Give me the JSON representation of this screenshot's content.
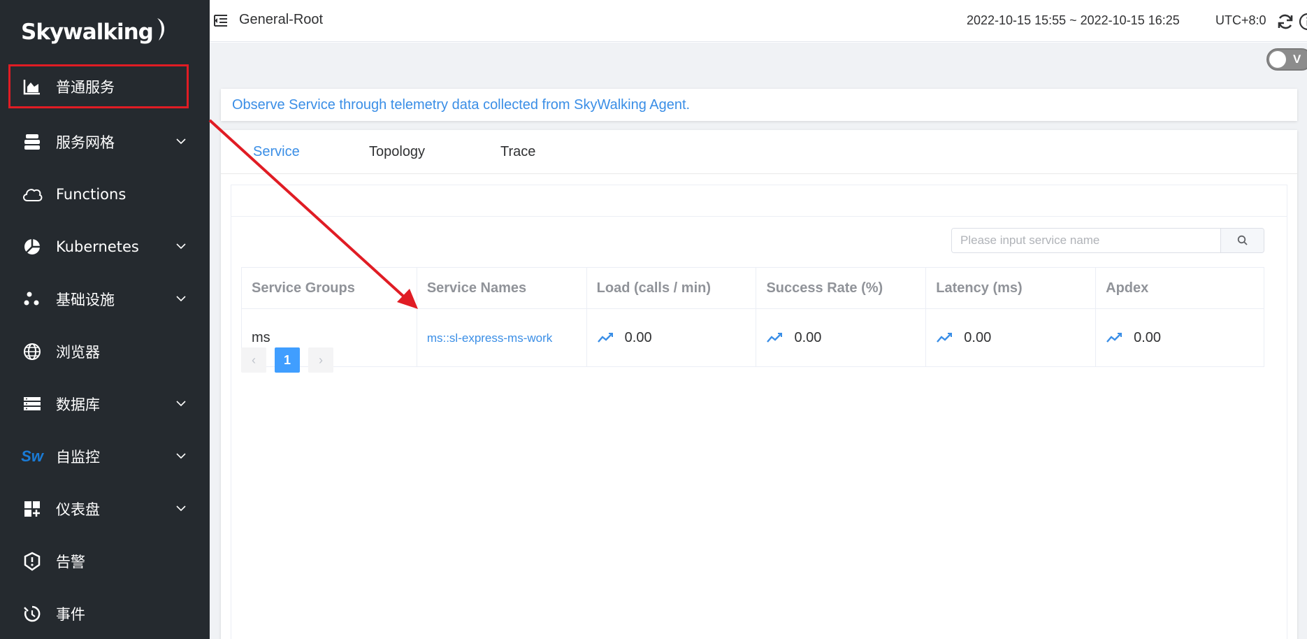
{
  "sidebar": {
    "logo": "Skywalking",
    "items": [
      {
        "label": "普通服务",
        "icon": "area-chart-icon",
        "chevron": false
      },
      {
        "label": "服务网格",
        "icon": "layers-icon",
        "chevron": true
      },
      {
        "label": "Functions",
        "icon": "cloud-icon",
        "chevron": false
      },
      {
        "label": "Kubernetes",
        "icon": "pie-chart-icon",
        "chevron": true
      },
      {
        "label": "基础设施",
        "icon": "dots-cluster-icon",
        "chevron": true
      },
      {
        "label": "浏览器",
        "icon": "globe-icon",
        "chevron": false
      },
      {
        "label": "数据库",
        "icon": "server-stack-icon",
        "chevron": true
      },
      {
        "label": "自监控",
        "icon": "sw-logo-icon",
        "chevron": true,
        "icon_text": "Sw"
      },
      {
        "label": "仪表盘",
        "icon": "dashboard-add-icon",
        "chevron": true
      },
      {
        "label": "告警",
        "icon": "alert-shield-icon",
        "chevron": false
      },
      {
        "label": "事件",
        "icon": "event-clock-icon",
        "chevron": false
      }
    ]
  },
  "header": {
    "title": "General-Root",
    "time_range": "2022-10-15 15:55 ~ 2022-10-15 16:25",
    "timezone": "UTC+8:0"
  },
  "toolbar": {
    "toggle_text": "V"
  },
  "main": {
    "description": "Observe Service through telemetry data collected from SkyWalking Agent.",
    "tabs": [
      "Service",
      "Topology",
      "Trace"
    ],
    "search": {
      "placeholder": "Please input service name",
      "value": ""
    },
    "table": {
      "headers": [
        "Service Groups",
        "Service Names",
        "Load (calls / min)",
        "Success Rate (%)",
        "Latency (ms)",
        "Apdex"
      ],
      "rows": [
        {
          "group": "ms",
          "name": "ms::sl-express-ms-work",
          "load": "0.00",
          "success": "0.00",
          "latency": "0.00",
          "apdex": "0.00"
        }
      ]
    },
    "pagination": {
      "current": "1",
      "prev": "‹",
      "next": "›"
    }
  },
  "colors": {
    "sidebar_bg": "#252a2f",
    "accent": "#3a8ee6",
    "highlight": "#e01c24",
    "page_active": "#409eff"
  }
}
